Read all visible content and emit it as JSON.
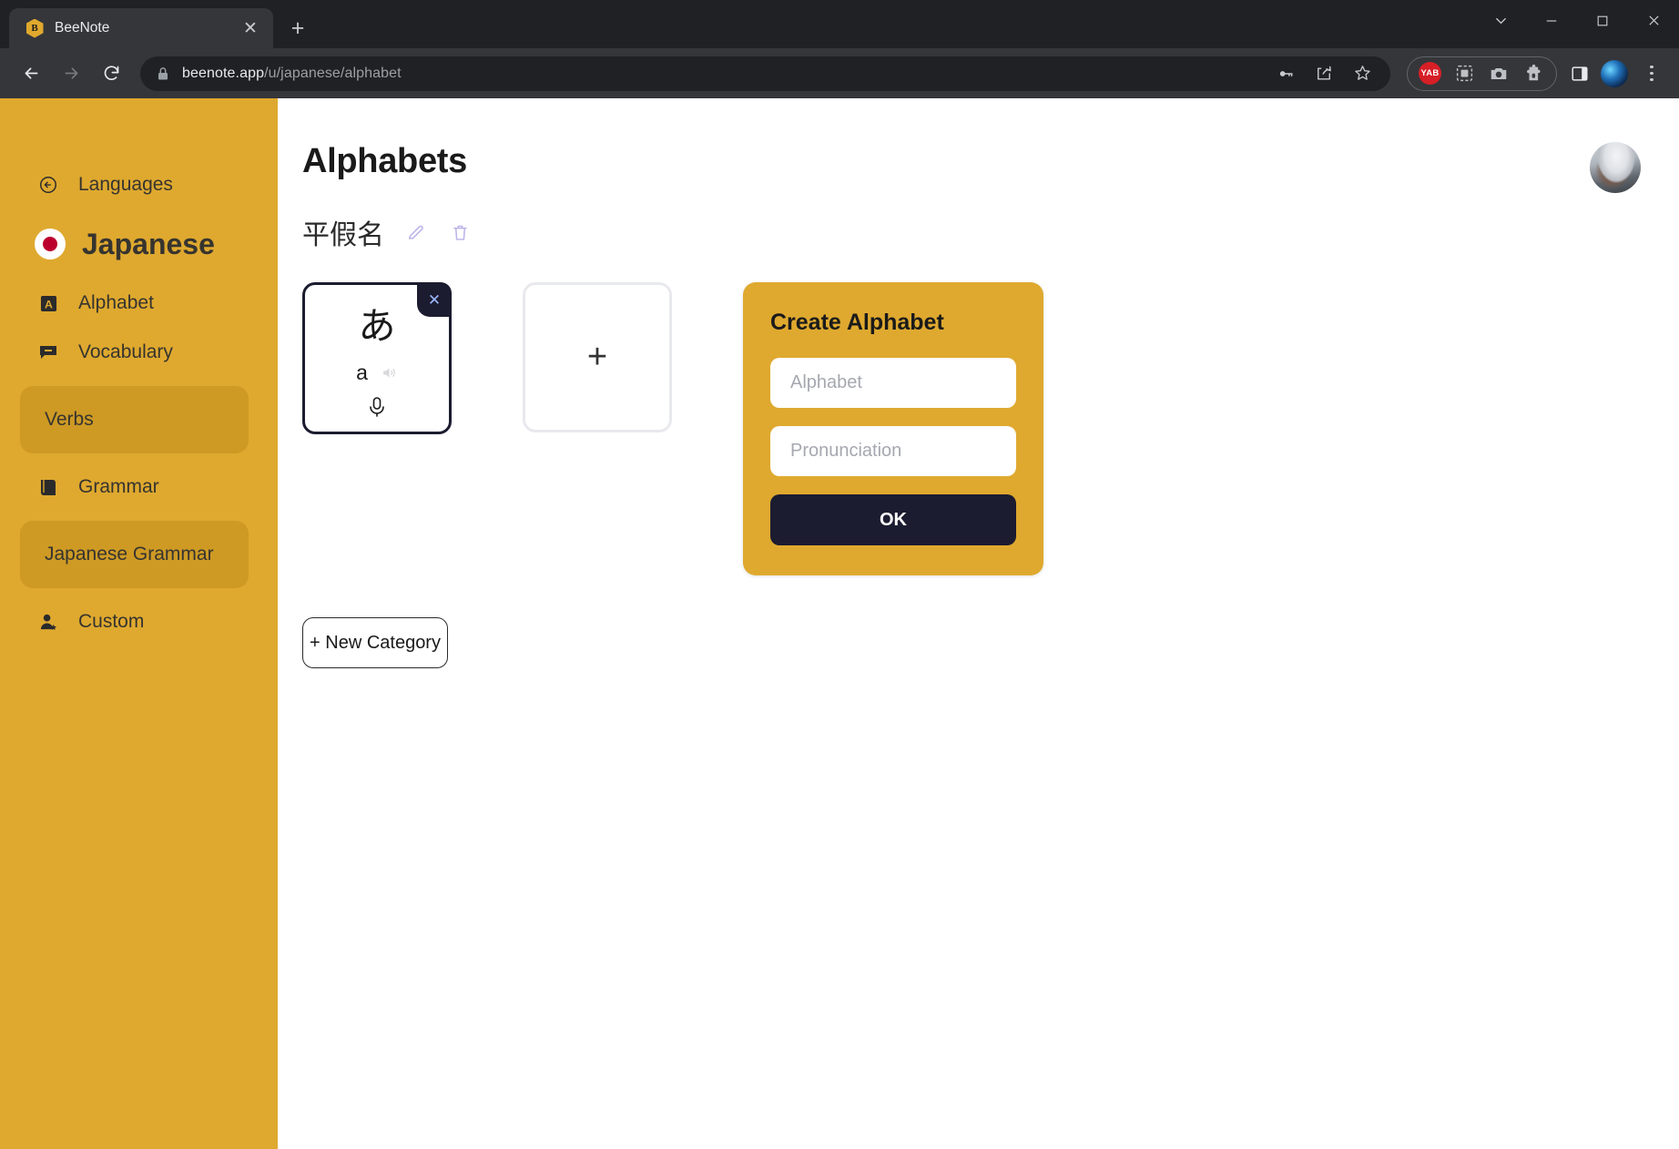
{
  "browser": {
    "tab": {
      "title": "BeeNote",
      "favicon": "bee-hex-icon",
      "favicon_letter": "B",
      "close_label": "✕"
    },
    "new_tab_label": "+",
    "window_controls": {
      "tab_search": "tab-search-chevron",
      "minimize": "—",
      "maximize": "□",
      "close": "✕"
    },
    "nav": {
      "back": "back-arrow",
      "forward": "forward-arrow",
      "reload": "reload-arrow"
    },
    "omnibox": {
      "lock": "lock-icon",
      "url_domain": "beenote.app",
      "url_path": "/u/japanese/alphabet",
      "actions": [
        "password-key-icon",
        "share-icon",
        "bookmark-star-icon"
      ]
    },
    "extensions": {
      "badge_label": "YAB",
      "icons": [
        "extension-frame-icon",
        "camera-icon",
        "puzzle-icon"
      ]
    },
    "toolbar_right": {
      "side_panel": "side-panel-icon",
      "profile": "profile-avatar",
      "menu": "kebab-menu-icon"
    }
  },
  "sidebar": {
    "back_item": {
      "label": "Languages",
      "icon": "back-circle-icon"
    },
    "language": {
      "label": "Japanese",
      "icon": "japan-flag-icon"
    },
    "items": [
      {
        "label": "Alphabet",
        "icon": "alphabet-a-icon",
        "type": "link"
      },
      {
        "label": "Vocabulary",
        "icon": "speech-bubble-icon",
        "type": "link"
      },
      {
        "label": "Verbs",
        "icon": "",
        "type": "panel"
      },
      {
        "label": "Grammar",
        "icon": "book-icon",
        "type": "link"
      },
      {
        "label": "Japanese Grammar",
        "icon": "",
        "type": "panel"
      },
      {
        "label": "Custom",
        "icon": "person-star-icon",
        "type": "link"
      }
    ]
  },
  "main": {
    "title": "Alphabets",
    "category": {
      "name": "平假名",
      "edit_icon": "pencil-icon",
      "delete_icon": "trash-icon"
    },
    "alphabet_card": {
      "character": "あ",
      "pronunciation": "a",
      "close_label": "✕",
      "speaker_icon": "speaker-icon",
      "mic_icon": "microphone-icon"
    },
    "add_card_label": "+",
    "new_category_label": "+ New Category"
  },
  "dialog": {
    "title": "Create Alphabet",
    "alphabet_placeholder": "Alphabet",
    "alphabet_value": "",
    "pronunciation_placeholder": "Pronunciation",
    "pronunciation_value": "",
    "ok_label": "OK"
  },
  "colors": {
    "brand_amber": "#DFA92F",
    "panel_amber": "#CE9A24",
    "dark_navy": "#1C1C30",
    "accent_lavender": "#B9B2E8",
    "chrome_dark": "#202124"
  }
}
